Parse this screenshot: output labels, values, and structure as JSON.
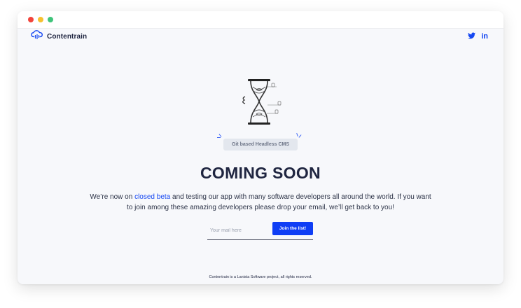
{
  "window": {
    "controls": [
      "close",
      "minimize",
      "maximize"
    ]
  },
  "header": {
    "logo_text": "Contentrain",
    "logo_icon": "cloud-rain-icon",
    "social": [
      {
        "name": "twitter",
        "icon": "twitter-icon"
      },
      {
        "name": "linkedin",
        "icon": "linkedin-icon",
        "glyph": "in"
      }
    ]
  },
  "hero": {
    "illustration": "hourglass-icon",
    "badge": "Git based Headless CMS",
    "title": "COMING SOON",
    "description_before": "We’re now on ",
    "description_link": "closed beta",
    "description_after": " and testing our app with many software developers all around the world. If you want to join among these amazing developers please drop your email, we’ll get back to you!"
  },
  "signup": {
    "email_placeholder": "Your mail here",
    "email_value": "",
    "button_label": "Join the list!"
  },
  "footer": {
    "text": "Contentrain is a Lanista Software project, all rights reserved."
  },
  "colors": {
    "accent": "#1648f2",
    "title": "#1f2540",
    "background": "#f7f8fb",
    "badge_bg": "#e3e7ee"
  }
}
